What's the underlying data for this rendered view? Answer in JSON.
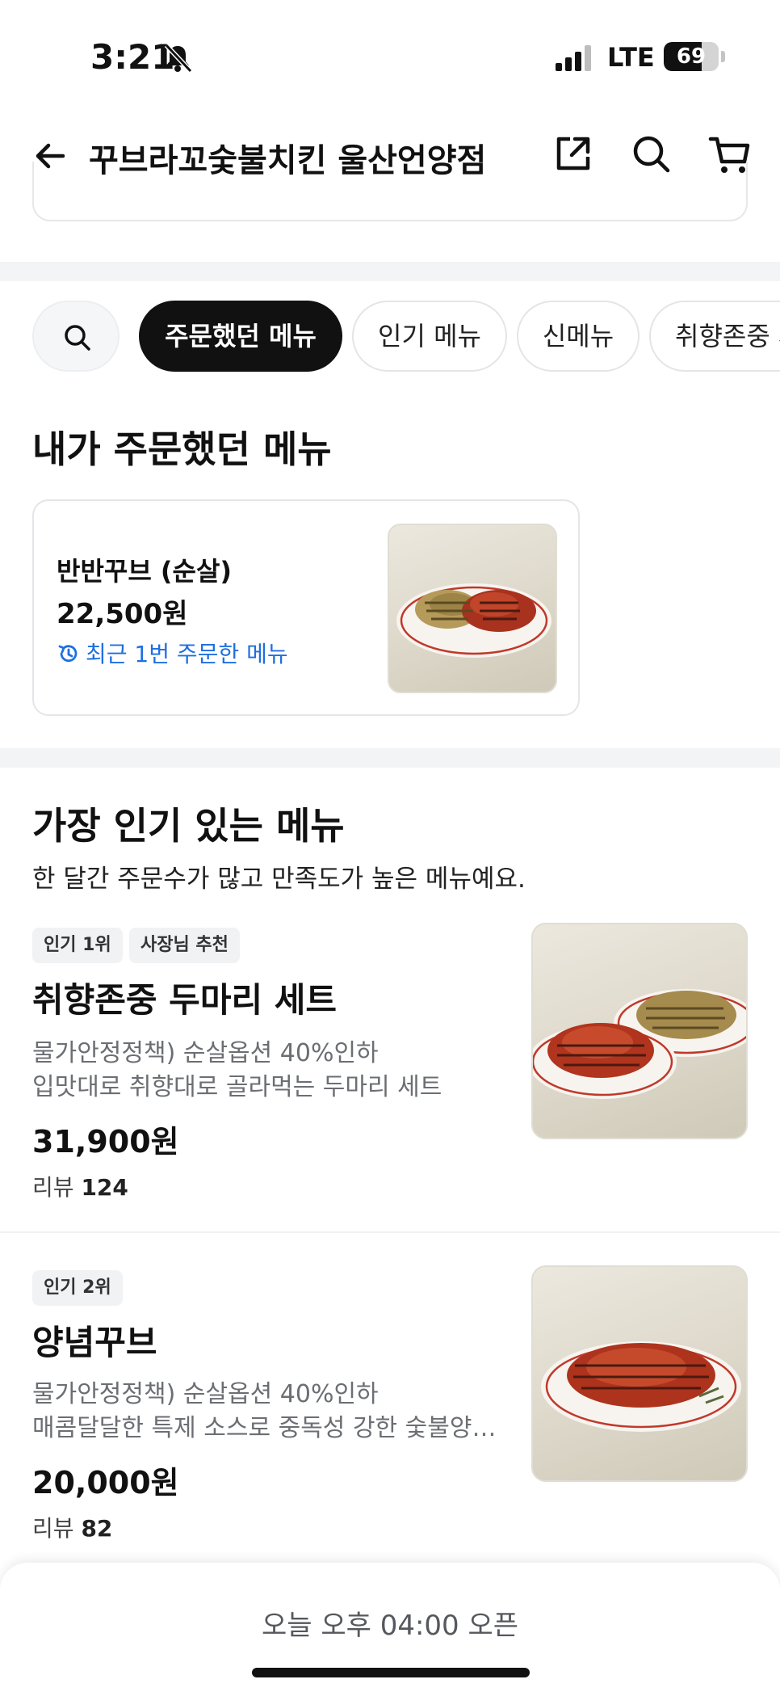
{
  "status_bar": {
    "time": "3:21",
    "network": "LTE",
    "battery": "69",
    "battery_level": 0.69
  },
  "header": {
    "title": "꾸브라꼬숯불치킨 울산언양점"
  },
  "categories": {
    "chips": [
      {
        "label": "주문했던 메뉴",
        "active": true
      },
      {
        "label": "인기 메뉴",
        "active": false
      },
      {
        "label": "신메뉴",
        "active": false
      },
      {
        "label": "취향존중 세트",
        "active": false
      }
    ]
  },
  "ordered_section": {
    "title": "내가 주문했던 메뉴",
    "item": {
      "name": "반반꾸브 (순살)",
      "price": "22,500원",
      "note": "최근 1번 주문한 메뉴"
    }
  },
  "popular_section": {
    "title": "가장 인기 있는 메뉴",
    "subtitle": "한 달간 주문수가 많고 만족도가 높은 메뉴예요.",
    "items": [
      {
        "badges": [
          "인기 1위",
          "사장님 추천"
        ],
        "name": "취향존중 두마리 세트",
        "desc_line1": "물가안정정책) 순살옵션 40%인하",
        "desc_line2": "입맛대로 취향대로 골라먹는 두마리 세트",
        "price": "31,900원",
        "review_label": "리뷰",
        "review_count": "124"
      },
      {
        "badges": [
          "인기 2위"
        ],
        "name": "양념꾸브",
        "desc_line1": "물가안정정책) 순살옵션 40%인하",
        "desc_line2": "매콤달달한 특제 소스로 중독성 강한 숯불양념치킨",
        "price": "20,000원",
        "review_label": "리뷰",
        "review_count": "82"
      }
    ]
  },
  "bottom_bar": {
    "open_text": "오늘 오후 04:00 오픈"
  },
  "colors": {
    "accent_blue": "#1f6fe0",
    "chip_active": "#111111",
    "divider": "#f3f4f6"
  },
  "icons": [
    "bell-slash-icon",
    "signal-icon",
    "back-arrow-icon",
    "share-icon",
    "search-icon",
    "cart-icon",
    "history-icon"
  ]
}
